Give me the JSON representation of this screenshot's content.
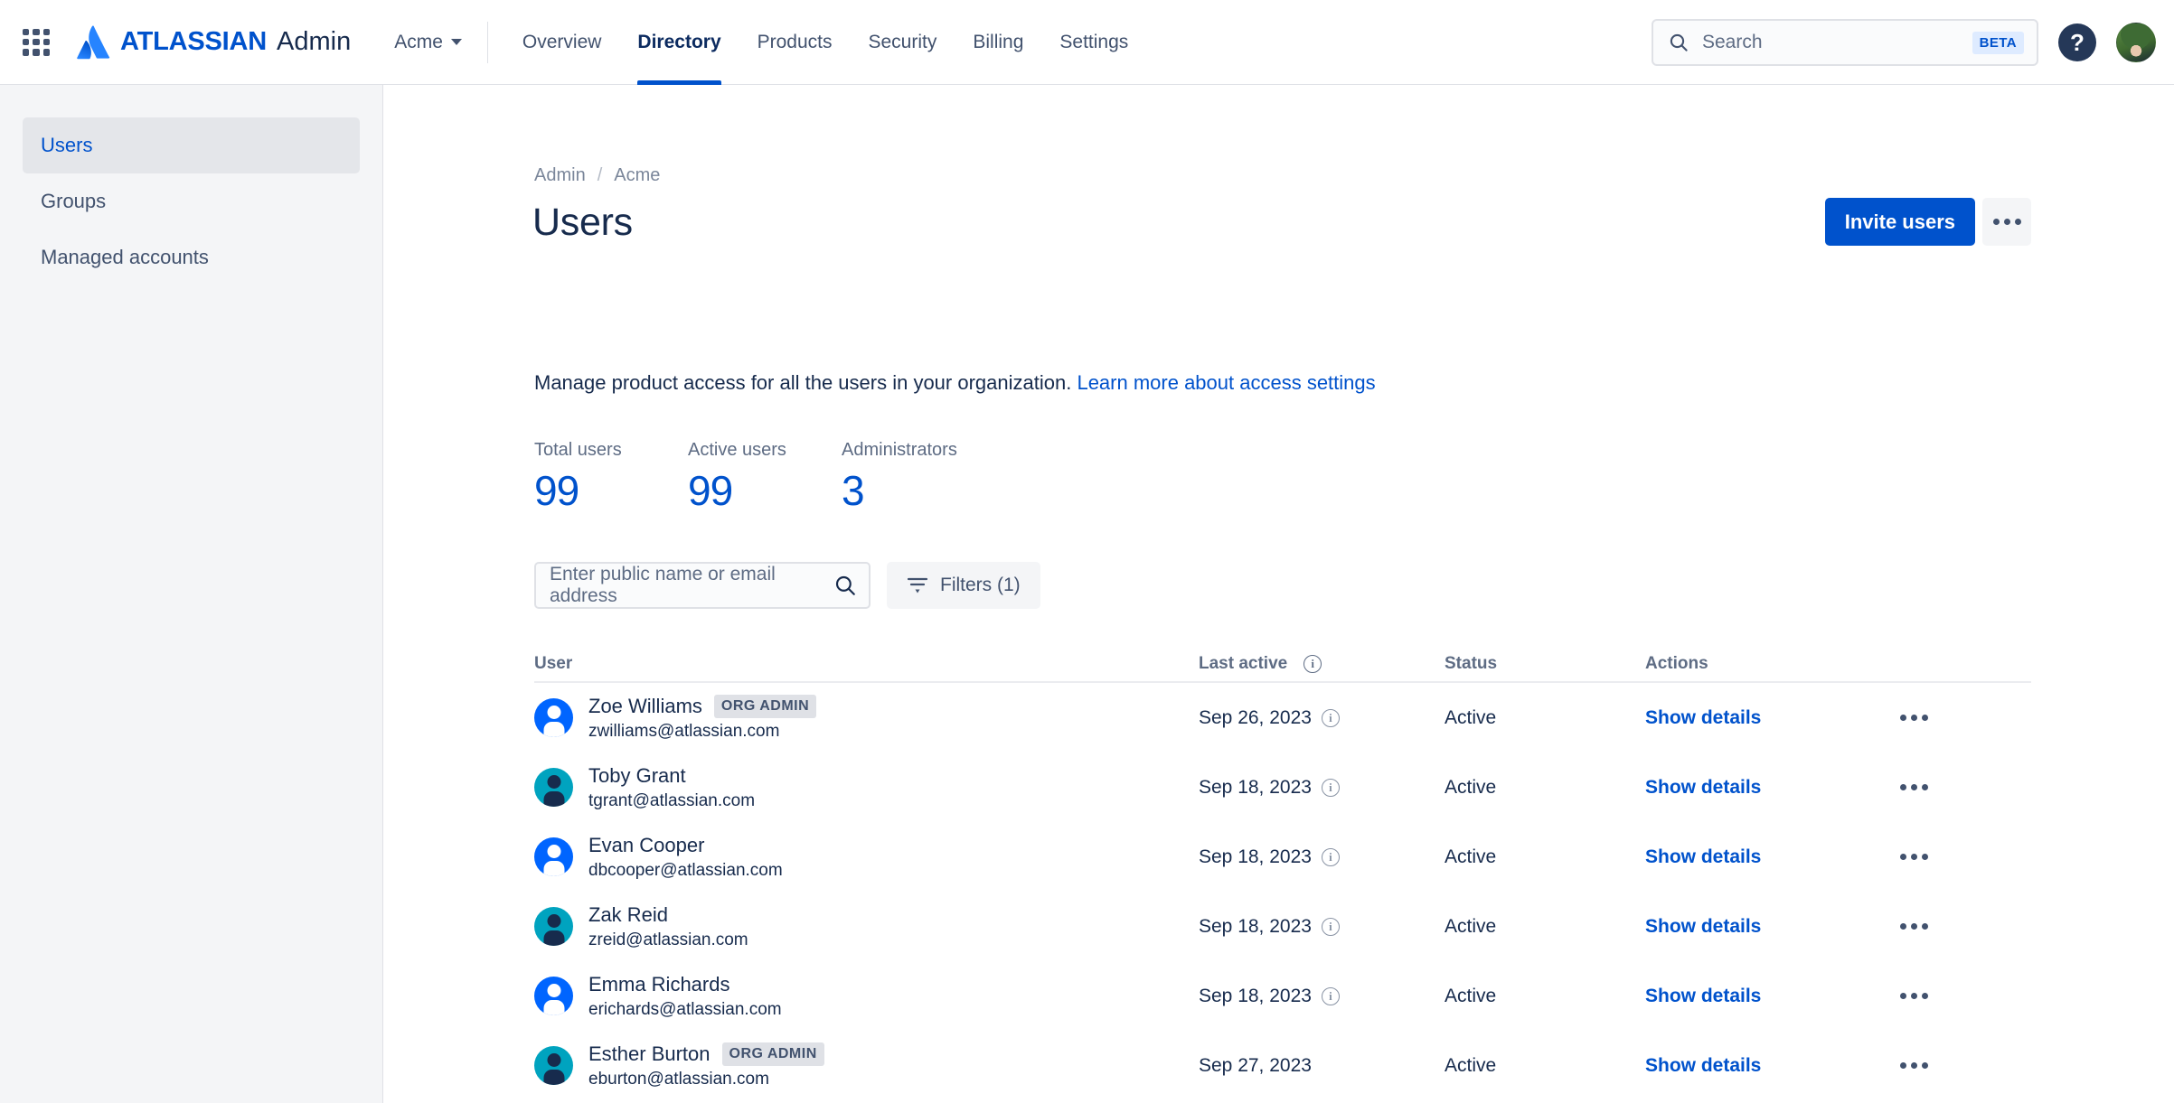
{
  "topnav": {
    "app_switcher": "app-switcher",
    "brand_word": "ATLASSIAN",
    "brand_admin": "Admin",
    "org_name": "Acme",
    "tabs": [
      {
        "label": "Overview",
        "active": false
      },
      {
        "label": "Directory",
        "active": true
      },
      {
        "label": "Products",
        "active": false
      },
      {
        "label": "Security",
        "active": false
      },
      {
        "label": "Billing",
        "active": false
      },
      {
        "label": "Settings",
        "active": false
      }
    ],
    "search": {
      "placeholder": "Search",
      "value": "",
      "badge": "BETA"
    },
    "help_label": "?"
  },
  "sidebar": {
    "items": [
      {
        "label": "Users",
        "active": true
      },
      {
        "label": "Groups",
        "active": false
      },
      {
        "label": "Managed accounts",
        "active": false
      }
    ]
  },
  "main": {
    "breadcrumb": {
      "root": "Admin",
      "separator": "/",
      "current": "Acme"
    },
    "page_title": "Users",
    "invite_label": "Invite users",
    "description_text": "Manage product access for all the users in your organization.",
    "description_link": "Learn more about access settings",
    "stats": [
      {
        "label": "Total users",
        "value": "99"
      },
      {
        "label": "Active users",
        "value": "99"
      },
      {
        "label": "Administrators",
        "value": "3"
      }
    ],
    "toolbar": {
      "search_placeholder": "Enter public name or email address",
      "search_value": "",
      "filters_label": "Filters (1)"
    },
    "table": {
      "headers": {
        "user": "User",
        "last_active": "Last active",
        "status": "Status",
        "actions": "Actions"
      },
      "rows": [
        {
          "name": "Zoe Williams",
          "tag": "ORG ADMIN",
          "email": "zwilliams@atlassian.com",
          "avatar_color": "blue",
          "last_active": "Sep 26, 2023",
          "has_info": true,
          "status": "Active",
          "action": "Show details"
        },
        {
          "name": "Toby Grant",
          "tag": "",
          "email": "tgrant@atlassian.com",
          "avatar_color": "teal",
          "last_active": "Sep 18, 2023",
          "has_info": true,
          "status": "Active",
          "action": "Show details"
        },
        {
          "name": "Evan Cooper",
          "tag": "",
          "email": "dbcooper@atlassian.com",
          "avatar_color": "blue",
          "last_active": "Sep 18, 2023",
          "has_info": true,
          "status": "Active",
          "action": "Show details"
        },
        {
          "name": "Zak Reid",
          "tag": "",
          "email": "zreid@atlassian.com",
          "avatar_color": "teal",
          "last_active": "Sep 18, 2023",
          "has_info": true,
          "status": "Active",
          "action": "Show details"
        },
        {
          "name": "Emma Richards",
          "tag": "",
          "email": "erichards@atlassian.com",
          "avatar_color": "blue",
          "last_active": "Sep 18, 2023",
          "has_info": true,
          "status": "Active",
          "action": "Show details"
        },
        {
          "name": "Esther Burton",
          "tag": "ORG ADMIN",
          "email": "eburton@atlassian.com",
          "avatar_color": "teal",
          "last_active": "Sep 27, 2023",
          "has_info": false,
          "status": "Active",
          "action": "Show details"
        }
      ]
    }
  },
  "colors": {
    "brand_blue": "#0052CC",
    "link_blue": "#0052CC",
    "text_dark": "#172B4D",
    "text_subtle": "#5E6C84",
    "sidebar_bg": "#F4F5F7",
    "avatar_blue": "#0065FF",
    "avatar_teal": "#00A3BF"
  }
}
